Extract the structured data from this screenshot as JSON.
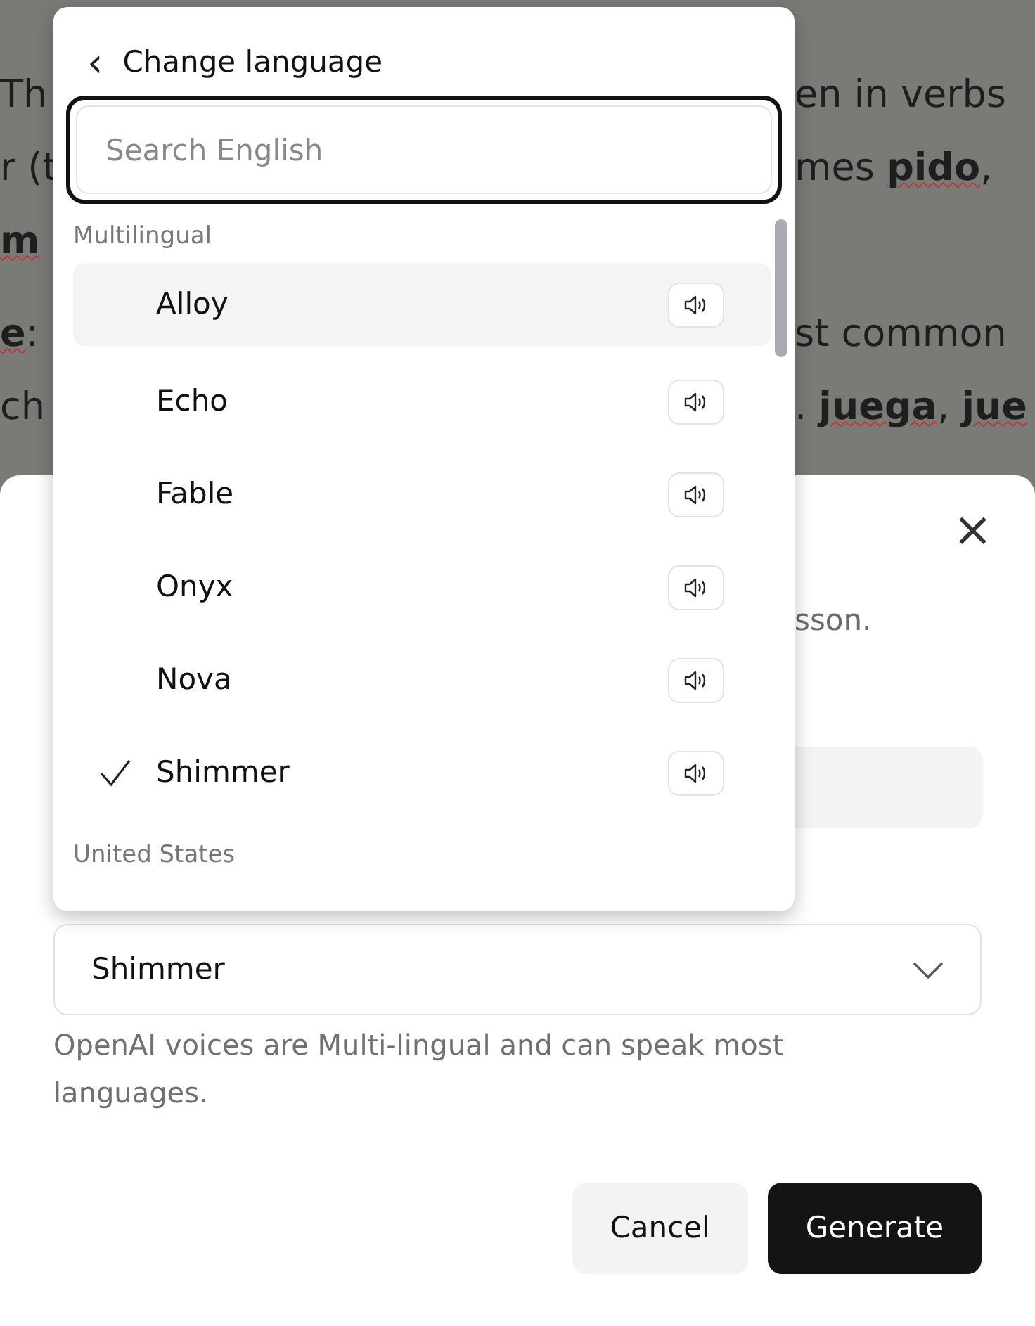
{
  "background_text": [
    [
      {
        "left": "Th",
        "right": "en in verbs"
      },
      {
        "left": "r (t",
        "right": "mes **pido**,"
      },
      {
        "left": "**m**"
      }
    ],
    [
      {
        "left": "**e**:",
        "right": "st common"
      },
      {
        "left": "ch",
        "right": ". **juega**, **jue**"
      }
    ]
  ],
  "dialog": {
    "close": "×",
    "description_fragment": "sson.",
    "voice_select": {
      "value": "Shimmer"
    },
    "helper": "OpenAI voices are Multi-lingual and can speak most languages.",
    "buttons": [
      {
        "label": "Cancel",
        "kind": "secondary"
      },
      {
        "label": "Generate",
        "kind": "primary"
      }
    ]
  },
  "language_menu": {
    "back": "‹",
    "title": "Change language",
    "search": {
      "placeholder": "Search English",
      "focused": true
    },
    "groups": [
      {
        "label": "Multilingual",
        "items": [
          {
            "name": "Alloy",
            "selected": false,
            "highlighted": true
          },
          {
            "name": "Echo",
            "selected": false,
            "highlighted": false
          },
          {
            "name": "Fable",
            "selected": false,
            "highlighted": false
          },
          {
            "name": "Onyx",
            "selected": false,
            "highlighted": false
          },
          {
            "name": "Nova",
            "selected": false,
            "highlighted": false
          },
          {
            "name": "Shimmer",
            "selected": true,
            "highlighted": false
          }
        ]
      },
      {
        "label": "United States"
      }
    ]
  }
}
